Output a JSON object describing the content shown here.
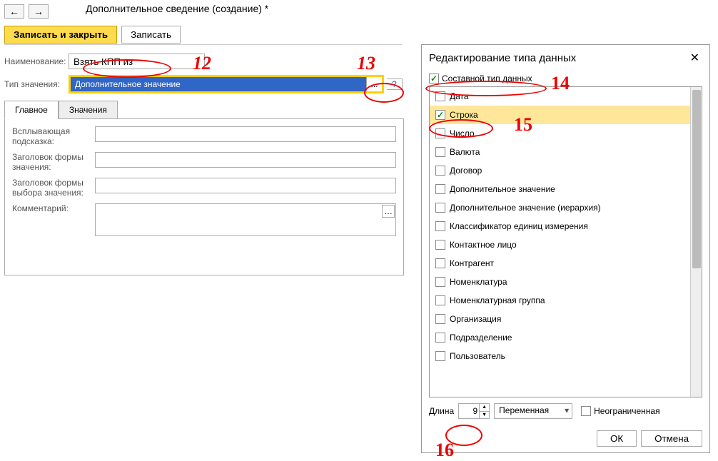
{
  "header": {
    "title": "Дополнительное сведение (создание) *"
  },
  "buttons": {
    "save_close": "Записать и закрыть",
    "save": "Записать"
  },
  "form": {
    "name_label": "Наименование:",
    "name_value": "Взять КПП из",
    "type_label": "Тип значения:",
    "type_value": "Дополнительное значение",
    "ellipsis": "...",
    "help": "?"
  },
  "tabs": {
    "main": "Главное",
    "values": "Значения"
  },
  "fields": {
    "tooltip_label": "Всплывающая подсказка:",
    "value_form_title_label": "Заголовок формы значения:",
    "choice_form_title_label": "Заголовок формы выбора значения:",
    "comment_label": "Комментарий:"
  },
  "dialog": {
    "title": "Редактирование типа данных",
    "composite_label": "Составной тип данных",
    "types": [
      {
        "label": "Дата",
        "checked": false
      },
      {
        "label": "Строка",
        "checked": true,
        "selected": true
      },
      {
        "label": "Число",
        "checked": false
      },
      {
        "label": "Валюта",
        "checked": false
      },
      {
        "label": "Договор",
        "checked": false
      },
      {
        "label": "Дополнительное значение",
        "checked": false
      },
      {
        "label": "Дополнительное значение (иерархия)",
        "checked": false
      },
      {
        "label": "Классификатор единиц измерения",
        "checked": false
      },
      {
        "label": "Контактное лицо",
        "checked": false
      },
      {
        "label": "Контрагент",
        "checked": false
      },
      {
        "label": "Номенклатура",
        "checked": false
      },
      {
        "label": "Номенклатурная группа",
        "checked": false
      },
      {
        "label": "Организация",
        "checked": false
      },
      {
        "label": "Подразделение",
        "checked": false
      },
      {
        "label": "Пользователь",
        "checked": false
      }
    ],
    "length_label": "Длина",
    "length_value": "9",
    "length_mode": "Переменная",
    "unlimited_label": "Неограниченная",
    "ok": "ОК",
    "cancel": "Отмена"
  },
  "annotations": {
    "a12": "12",
    "a13": "13",
    "a14": "14",
    "a15": "15",
    "a16": "16"
  }
}
